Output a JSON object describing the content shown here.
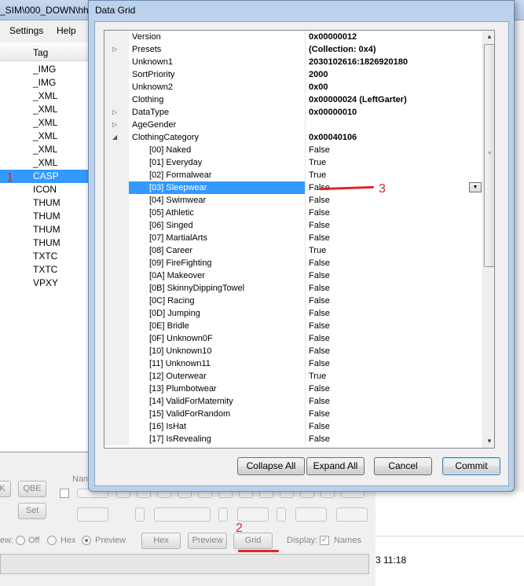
{
  "background_app": {
    "title_fragment": "_SIM\\000_DOWN\\hh",
    "menu": [
      "Settings",
      "Help"
    ],
    "list_header": "Tag",
    "tags": [
      "_IMG",
      "_IMG",
      "_XML",
      "_XML",
      "_XML",
      "_XML",
      "_XML",
      "_XML",
      "CASP",
      "ICON",
      "THUM",
      "THUM",
      "THUM",
      "THUM",
      "TXTC",
      "TXTC",
      "VPXY"
    ],
    "selected_tag_index": 8,
    "panel": {
      "btn_k": "K",
      "btn_qbe": "QBE",
      "btn_set": "Set",
      "label_name": "Nam",
      "view_label": "ew:",
      "radio_off": "Off",
      "radio_hex": "Hex",
      "radio_preview": "Preview",
      "selected_radio": "Preview",
      "btn_hex": "Hex",
      "btn_preview": "Preview",
      "btn_grid": "Grid",
      "display_label": "Display:",
      "names_label": "Names",
      "names_checked": true
    },
    "status_time": "3 11:18"
  },
  "annotations": {
    "one": "1",
    "two": "2",
    "three": "3",
    "color": "#e0262a"
  },
  "dialog": {
    "title": "Data Grid",
    "rows": [
      {
        "name": "Version",
        "value": "0x00000012",
        "indent": 0,
        "expander": "",
        "bold": true
      },
      {
        "name": "Presets",
        "value": "(Collection: 0x4)",
        "indent": 0,
        "expander": "collapsed",
        "bold": true
      },
      {
        "name": "Unknown1",
        "value": "2030102616:1826920180",
        "indent": 0,
        "expander": "",
        "bold": true
      },
      {
        "name": "SortPriority",
        "value": "2000",
        "indent": 0,
        "expander": "",
        "bold": true
      },
      {
        "name": "Unknown2",
        "value": "0x00",
        "indent": 0,
        "expander": "",
        "bold": true
      },
      {
        "name": "Clothing",
        "value": "0x00000024 (LeftGarter)",
        "indent": 0,
        "expander": "",
        "bold": true
      },
      {
        "name": "DataType",
        "value": "0x00000010",
        "indent": 0,
        "expander": "collapsed",
        "bold": true
      },
      {
        "name": "AgeGender",
        "value": "",
        "indent": 0,
        "expander": "collapsed",
        "bold": false
      },
      {
        "name": "ClothingCategory",
        "value": "0x00040106",
        "indent": 0,
        "expander": "expanded",
        "bold": true
      },
      {
        "name": "[00] Naked",
        "value": "False",
        "indent": 1,
        "expander": "",
        "bold": false
      },
      {
        "name": "[01] Everyday",
        "value": "True",
        "indent": 1,
        "expander": "",
        "bold": false
      },
      {
        "name": "[02] Formalwear",
        "value": "True",
        "indent": 1,
        "expander": "",
        "bold": false
      },
      {
        "name": "[03] Sleepwear",
        "value": "False",
        "indent": 1,
        "expander": "",
        "bold": false,
        "selected": true
      },
      {
        "name": "[04] Swimwear",
        "value": "False",
        "indent": 1,
        "expander": "",
        "bold": false
      },
      {
        "name": "[05] Athletic",
        "value": "False",
        "indent": 1,
        "expander": "",
        "bold": false
      },
      {
        "name": "[06] Singed",
        "value": "False",
        "indent": 1,
        "expander": "",
        "bold": false
      },
      {
        "name": "[07] MartialArts",
        "value": "False",
        "indent": 1,
        "expander": "",
        "bold": false
      },
      {
        "name": "[08] Career",
        "value": "True",
        "indent": 1,
        "expander": "",
        "bold": false
      },
      {
        "name": "[09] FireFighting",
        "value": "False",
        "indent": 1,
        "expander": "",
        "bold": false
      },
      {
        "name": "[0A] Makeover",
        "value": "False",
        "indent": 1,
        "expander": "",
        "bold": false
      },
      {
        "name": "[0B] SkinnyDippingTowel",
        "value": "False",
        "indent": 1,
        "expander": "",
        "bold": false
      },
      {
        "name": "[0C] Racing",
        "value": "False",
        "indent": 1,
        "expander": "",
        "bold": false
      },
      {
        "name": "[0D] Jumping",
        "value": "False",
        "indent": 1,
        "expander": "",
        "bold": false
      },
      {
        "name": "[0E] Bridle",
        "value": "False",
        "indent": 1,
        "expander": "",
        "bold": false
      },
      {
        "name": "[0F] Unknown0F",
        "value": "False",
        "indent": 1,
        "expander": "",
        "bold": false
      },
      {
        "name": "[10] Unknown10",
        "value": "False",
        "indent": 1,
        "expander": "",
        "bold": false
      },
      {
        "name": "[11] Unknown11",
        "value": "False",
        "indent": 1,
        "expander": "",
        "bold": false
      },
      {
        "name": "[12] Outerwear",
        "value": "True",
        "indent": 1,
        "expander": "",
        "bold": false
      },
      {
        "name": "[13] Plumbotwear",
        "value": "False",
        "indent": 1,
        "expander": "",
        "bold": false
      },
      {
        "name": "[14] ValidForMaternity",
        "value": "False",
        "indent": 1,
        "expander": "",
        "bold": false
      },
      {
        "name": "[15] ValidForRandom",
        "value": "False",
        "indent": 1,
        "expander": "",
        "bold": false
      },
      {
        "name": "[16] IsHat",
        "value": "False",
        "indent": 1,
        "expander": "",
        "bold": false
      },
      {
        "name": "[17] IsRevealing",
        "value": "False",
        "indent": 1,
        "expander": "",
        "bold": false
      }
    ],
    "buttons": {
      "collapse_all": "Collapse All",
      "expand_all": "Expand All",
      "cancel": "Cancel",
      "commit": "Commit"
    },
    "icons": {
      "expander_collapsed": "triangle-right-icon",
      "expander_expanded": "triangle-down-icon",
      "dropdown": "chevron-down-icon",
      "scroll_up": "arrow-up-icon",
      "scroll_down": "arrow-down-icon"
    }
  },
  "colors": {
    "selection": "#3399ff",
    "dialog_frame": "#bcd1ec"
  }
}
